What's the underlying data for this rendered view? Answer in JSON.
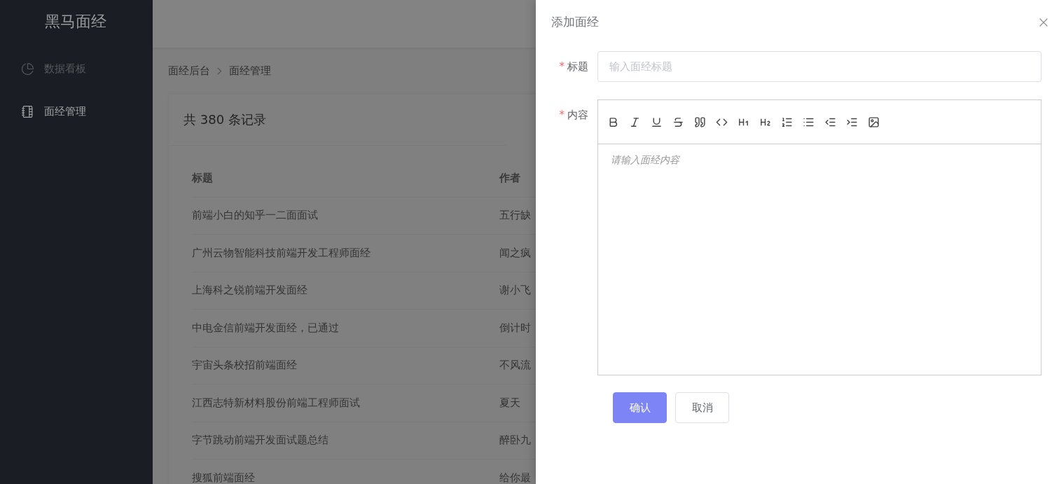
{
  "sidebar": {
    "logo": "黑马面经",
    "items": [
      {
        "label": "数据看板",
        "selected": false
      },
      {
        "label": "面经管理",
        "selected": true
      }
    ]
  },
  "breadcrumb": [
    "面经后台",
    "面经管理"
  ],
  "card": {
    "title": "共 380 条记录",
    "table": {
      "columns": [
        "标题",
        "作者"
      ],
      "rows": [
        [
          "前端小白的知乎一二面面试",
          "五行缺"
        ],
        [
          "广州云物智能科技前端开发工程师面经",
          "闻之疯"
        ],
        [
          "上海科之锐前端开发面经",
          "谢小飞"
        ],
        [
          "中电金信前端开发面经，已通过",
          "倒计时"
        ],
        [
          "宇宙头条校招前端面经",
          "不风流"
        ],
        [
          "江西志特新材料股份前端工程师面试",
          "夏天"
        ],
        [
          "字节跳动前端开发面试题总结",
          "醉卧九"
        ],
        [
          "搜狐前端面经",
          "给你最"
        ]
      ]
    }
  },
  "drawer": {
    "title": "添加面经",
    "fields": [
      {
        "kind": "input",
        "mark": "*",
        "label": "标题",
        "placeholder": "输入面经标题"
      },
      {
        "kind": "editor",
        "mark": "*",
        "label": "内容",
        "placeholder": "请输入面经内容"
      }
    ],
    "buttons": [
      {
        "label": "确认",
        "kind": "primary"
      },
      {
        "label": "取消",
        "kind": "default"
      }
    ]
  }
}
